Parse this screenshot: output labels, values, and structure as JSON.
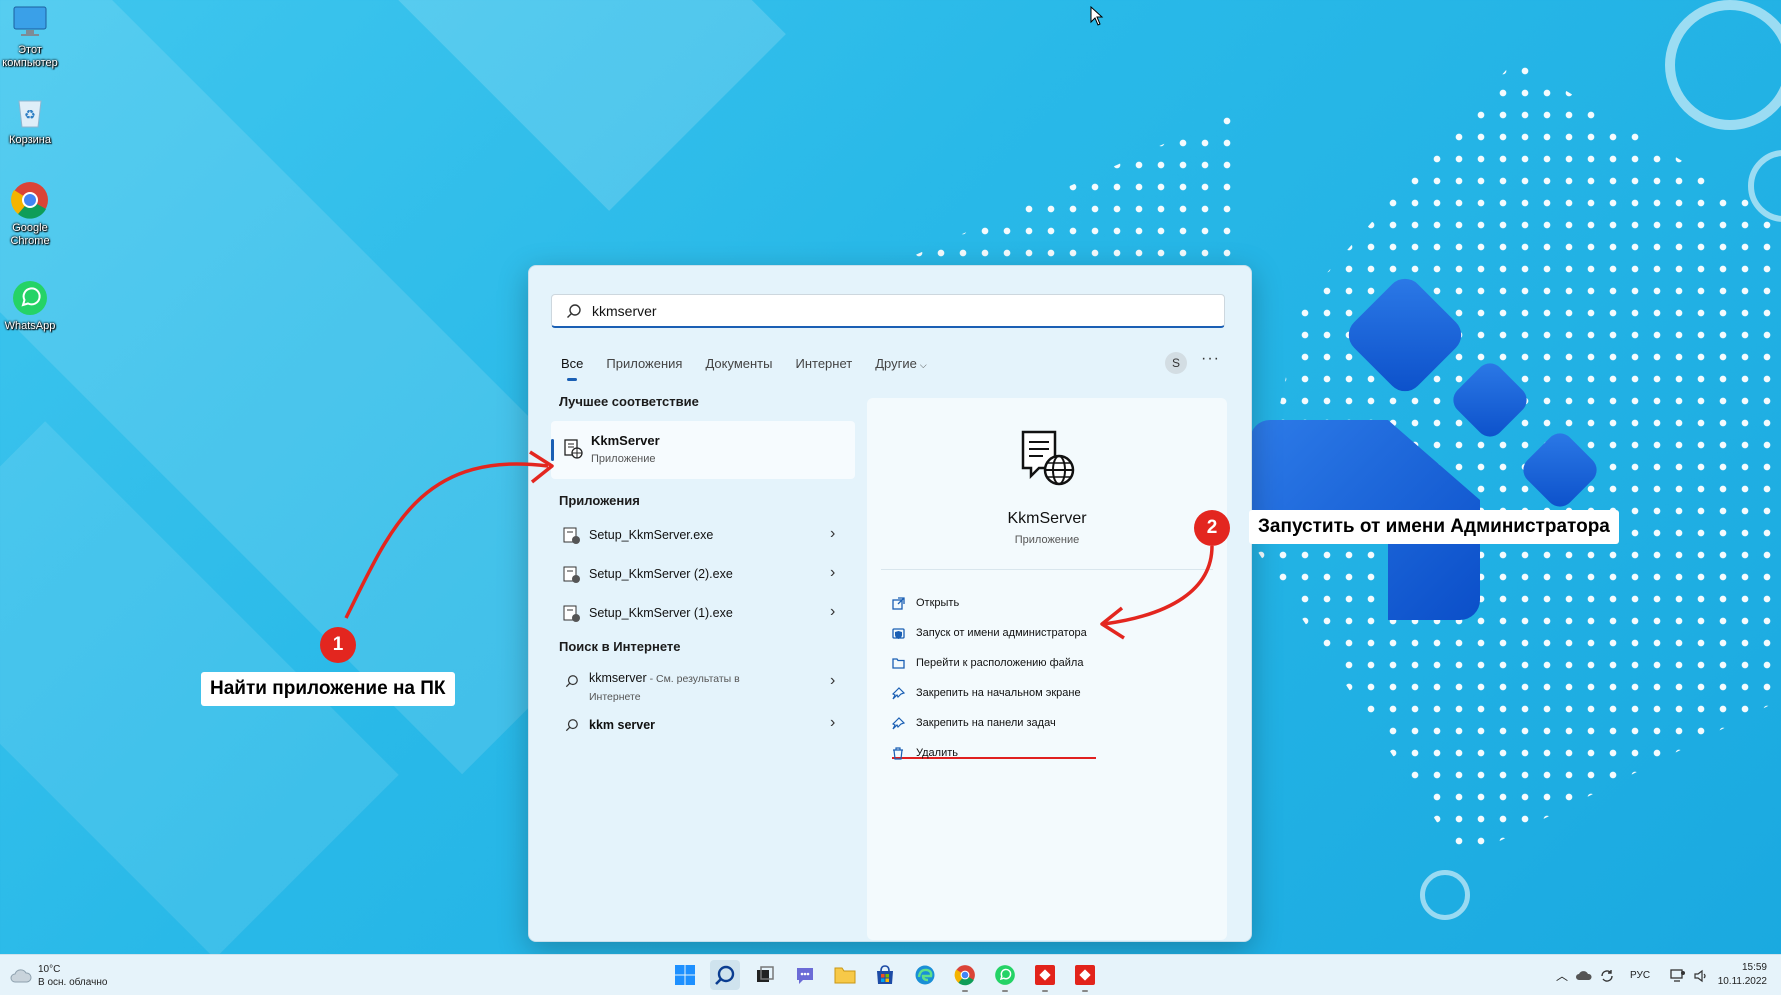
{
  "desktop_icons": [
    {
      "label": "Этот\nкомпьютер",
      "icon": "computer-icon"
    },
    {
      "label": "Корзина",
      "icon": "recycle-bin-icon"
    },
    {
      "label": "Google\nChrome",
      "icon": "chrome-icon"
    },
    {
      "label": "WhatsApp",
      "icon": "whatsapp-icon"
    }
  ],
  "search": {
    "value": "kkmserver",
    "icon": "search-icon"
  },
  "tabs": [
    {
      "label": "Все",
      "active": true
    },
    {
      "label": "Приложения"
    },
    {
      "label": "Документы"
    },
    {
      "label": "Интернет"
    },
    {
      "label": "Другие",
      "has_dropdown": true
    }
  ],
  "user_initial": "S",
  "more_label": "···",
  "best_match": {
    "section_title": "Лучшее соответствие",
    "name": "KkmServer",
    "type": "Приложение"
  },
  "apps": {
    "section_title": "Приложения",
    "items": [
      {
        "name": "Setup_KkmServer.exe"
      },
      {
        "name": "Setup_KkmServer (2).exe"
      },
      {
        "name": "Setup_KkmServer (1).exe"
      }
    ]
  },
  "web": {
    "section_title": "Поиск в Интернете",
    "items": [
      {
        "query": "kkmserver",
        "hint": " - См. результаты в",
        "hint2": "Интернете"
      },
      {
        "query": "kkm server",
        "hint": "",
        "hint2": ""
      }
    ]
  },
  "detail": {
    "name": "KkmServer",
    "type": "Приложение",
    "actions": [
      {
        "label": "Открыть",
        "icon": "open-icon"
      },
      {
        "label": "Запуск от имени администратора",
        "icon": "shield-icon",
        "highlighted": true
      },
      {
        "label": "Перейти к расположению файла",
        "icon": "folder-icon"
      },
      {
        "label": "Закрепить на начальном экране",
        "icon": "pin-icon"
      },
      {
        "label": "Закрепить на панели задач",
        "icon": "pin-icon"
      },
      {
        "label": "Удалить",
        "icon": "trash-icon"
      }
    ]
  },
  "annotations": [
    {
      "number": "1",
      "text": "Найти приложение на ПК"
    },
    {
      "number": "2",
      "text": "Запустить от имени Администратора"
    }
  ],
  "taskbar": {
    "weather_temp": "10°C",
    "weather_desc": "В осн. облачно",
    "language": "РУС",
    "time": "15:59",
    "date": "10.11.2022"
  },
  "colors": {
    "accent": "#1a5fb4",
    "annotation_red": "#e3261f"
  }
}
